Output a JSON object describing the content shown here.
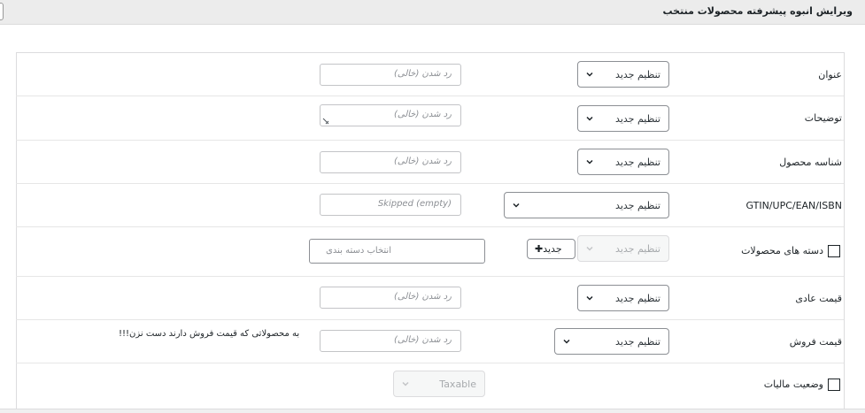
{
  "header": {
    "title": "ویرایش انبوه پیشرفته محصولات منتخب"
  },
  "rows": {
    "title": {
      "label": "عنوان",
      "select": "تنظیم جدید",
      "placeholder": "رد شدن (خالی)"
    },
    "description": {
      "label": "توضیحات",
      "select": "تنظیم جدید",
      "placeholder": "رد شدن (خالی)"
    },
    "sku": {
      "label": "شناسه محصول",
      "select": "تنظیم جدید",
      "placeholder": "رد شدن (خالی)"
    },
    "gtin": {
      "label": "GTIN/UPC/EAN/ISBN",
      "select": "تنظیم جدید",
      "placeholder": "Skipped (empty)"
    },
    "categories": {
      "label": "دسته های محصولات",
      "select": "تنظیم جدید",
      "new_button": "جدید",
      "category_placeholder": "انتخاب دسته بندی"
    },
    "regular_price": {
      "label": "قیمت عادی",
      "select": "تنظیم جدید",
      "placeholder": "رد شدن (خالی)"
    },
    "sale_price": {
      "label": "قیمت فروش",
      "select": "تنظیم جدید",
      "placeholder": "رد شدن (خالی)",
      "note": "به محصولاتی که قیمت فروش دارند دست نزن!!!"
    },
    "tax_status": {
      "label": "وضعیت مالیات",
      "select": "Taxable"
    }
  },
  "icons": {
    "chevron": "chevron-down-icon",
    "plus": "plus-icon"
  },
  "colors": {
    "header_bg": "#ececec",
    "border": "#8c8f94",
    "text": "#1d2327",
    "placeholder": "#8c8f94"
  }
}
